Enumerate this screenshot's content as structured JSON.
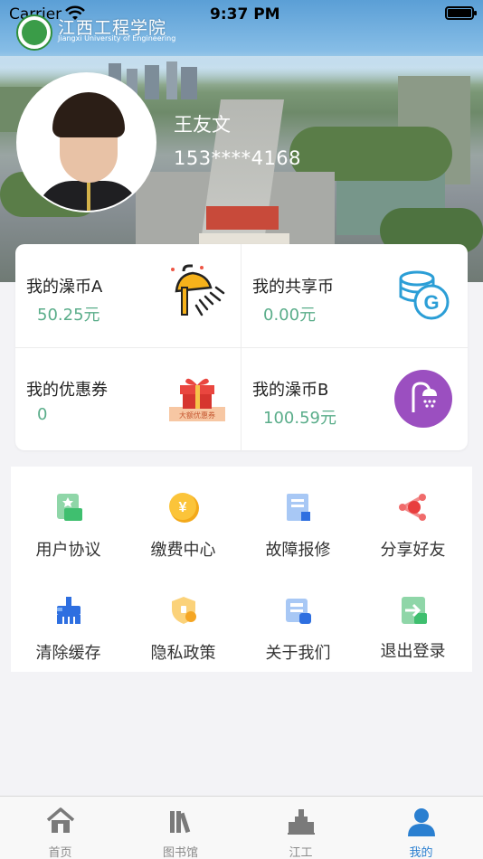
{
  "status_bar": {
    "carrier": "Carrier",
    "time": "9:37 PM"
  },
  "header": {
    "school_name_cn": "江西工程学院",
    "school_name_en": "Jiangxi University of Engineering",
    "user_name": "王友文",
    "user_phone": "153****4168"
  },
  "wallet": {
    "items": [
      {
        "label": "我的澡币A",
        "value": "50.25元",
        "icon": "shower-head-icon"
      },
      {
        "label": "我的共享币",
        "value": "0.00元",
        "icon": "coins-g-icon"
      },
      {
        "label": "我的优惠券",
        "value": "0",
        "icon": "gift-coupon-icon",
        "icon_caption": "大额优惠券"
      },
      {
        "label": "我的澡币B",
        "value": "100.59元",
        "icon": "shower-circle-icon"
      }
    ]
  },
  "menu": {
    "items": [
      {
        "label": "用户协议",
        "icon": "document-icon"
      },
      {
        "label": "缴费中心",
        "icon": "yen-coin-icon"
      },
      {
        "label": "故障报修",
        "icon": "repair-form-icon"
      },
      {
        "label": "分享好友",
        "icon": "share-icon"
      },
      {
        "label": "清除缓存",
        "icon": "broom-icon"
      },
      {
        "label": "隐私政策",
        "icon": "shield-icon"
      },
      {
        "label": "关于我们",
        "icon": "info-card-icon"
      },
      {
        "label": "退出登录",
        "icon": "logout-icon"
      }
    ]
  },
  "tabbar": {
    "items": [
      {
        "label": "首页",
        "icon": "home-icon",
        "active": false
      },
      {
        "label": "图书馆",
        "icon": "books-icon",
        "active": false
      },
      {
        "label": "江工",
        "icon": "campus-building-icon",
        "active": false
      },
      {
        "label": "我的",
        "icon": "profile-icon",
        "active": true
      }
    ]
  },
  "colors": {
    "accent_green": "#5aad8a",
    "tab_active": "#2a7fd0",
    "tab_inactive": "#8a8a8a"
  }
}
